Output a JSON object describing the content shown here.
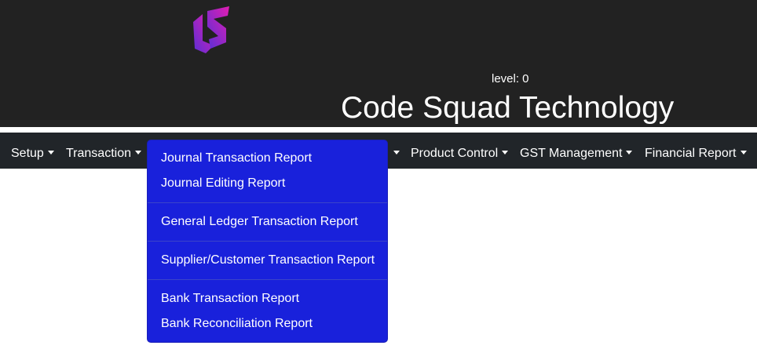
{
  "header": {
    "level_text": "level: 0",
    "brand_name": "Code Squad Technology",
    "logo_icon": "cs-logo-icon"
  },
  "navbar": {
    "items": [
      {
        "label": "Setup"
      },
      {
        "label": "Transaction"
      },
      {
        "label": "Product Control"
      },
      {
        "label": "GST Management"
      },
      {
        "label": "Financial Report"
      }
    ]
  },
  "dropdown": {
    "groups": [
      {
        "items": [
          "Journal Transaction Report",
          "Journal Editing Report"
        ]
      },
      {
        "items": [
          "General Ledger Transaction Report"
        ]
      },
      {
        "items": [
          "Supplier/Customer Transaction Report"
        ]
      },
      {
        "items": [
          "Bank Transaction Report",
          "Bank Reconciliation Report"
        ]
      }
    ]
  },
  "colors": {
    "header_bg": "#222222",
    "navbar_bg": "#212529",
    "dropdown_bg": "#1921db",
    "logo_gradient_start": "#6a2ddc",
    "logo_gradient_end": "#e01fb5"
  }
}
